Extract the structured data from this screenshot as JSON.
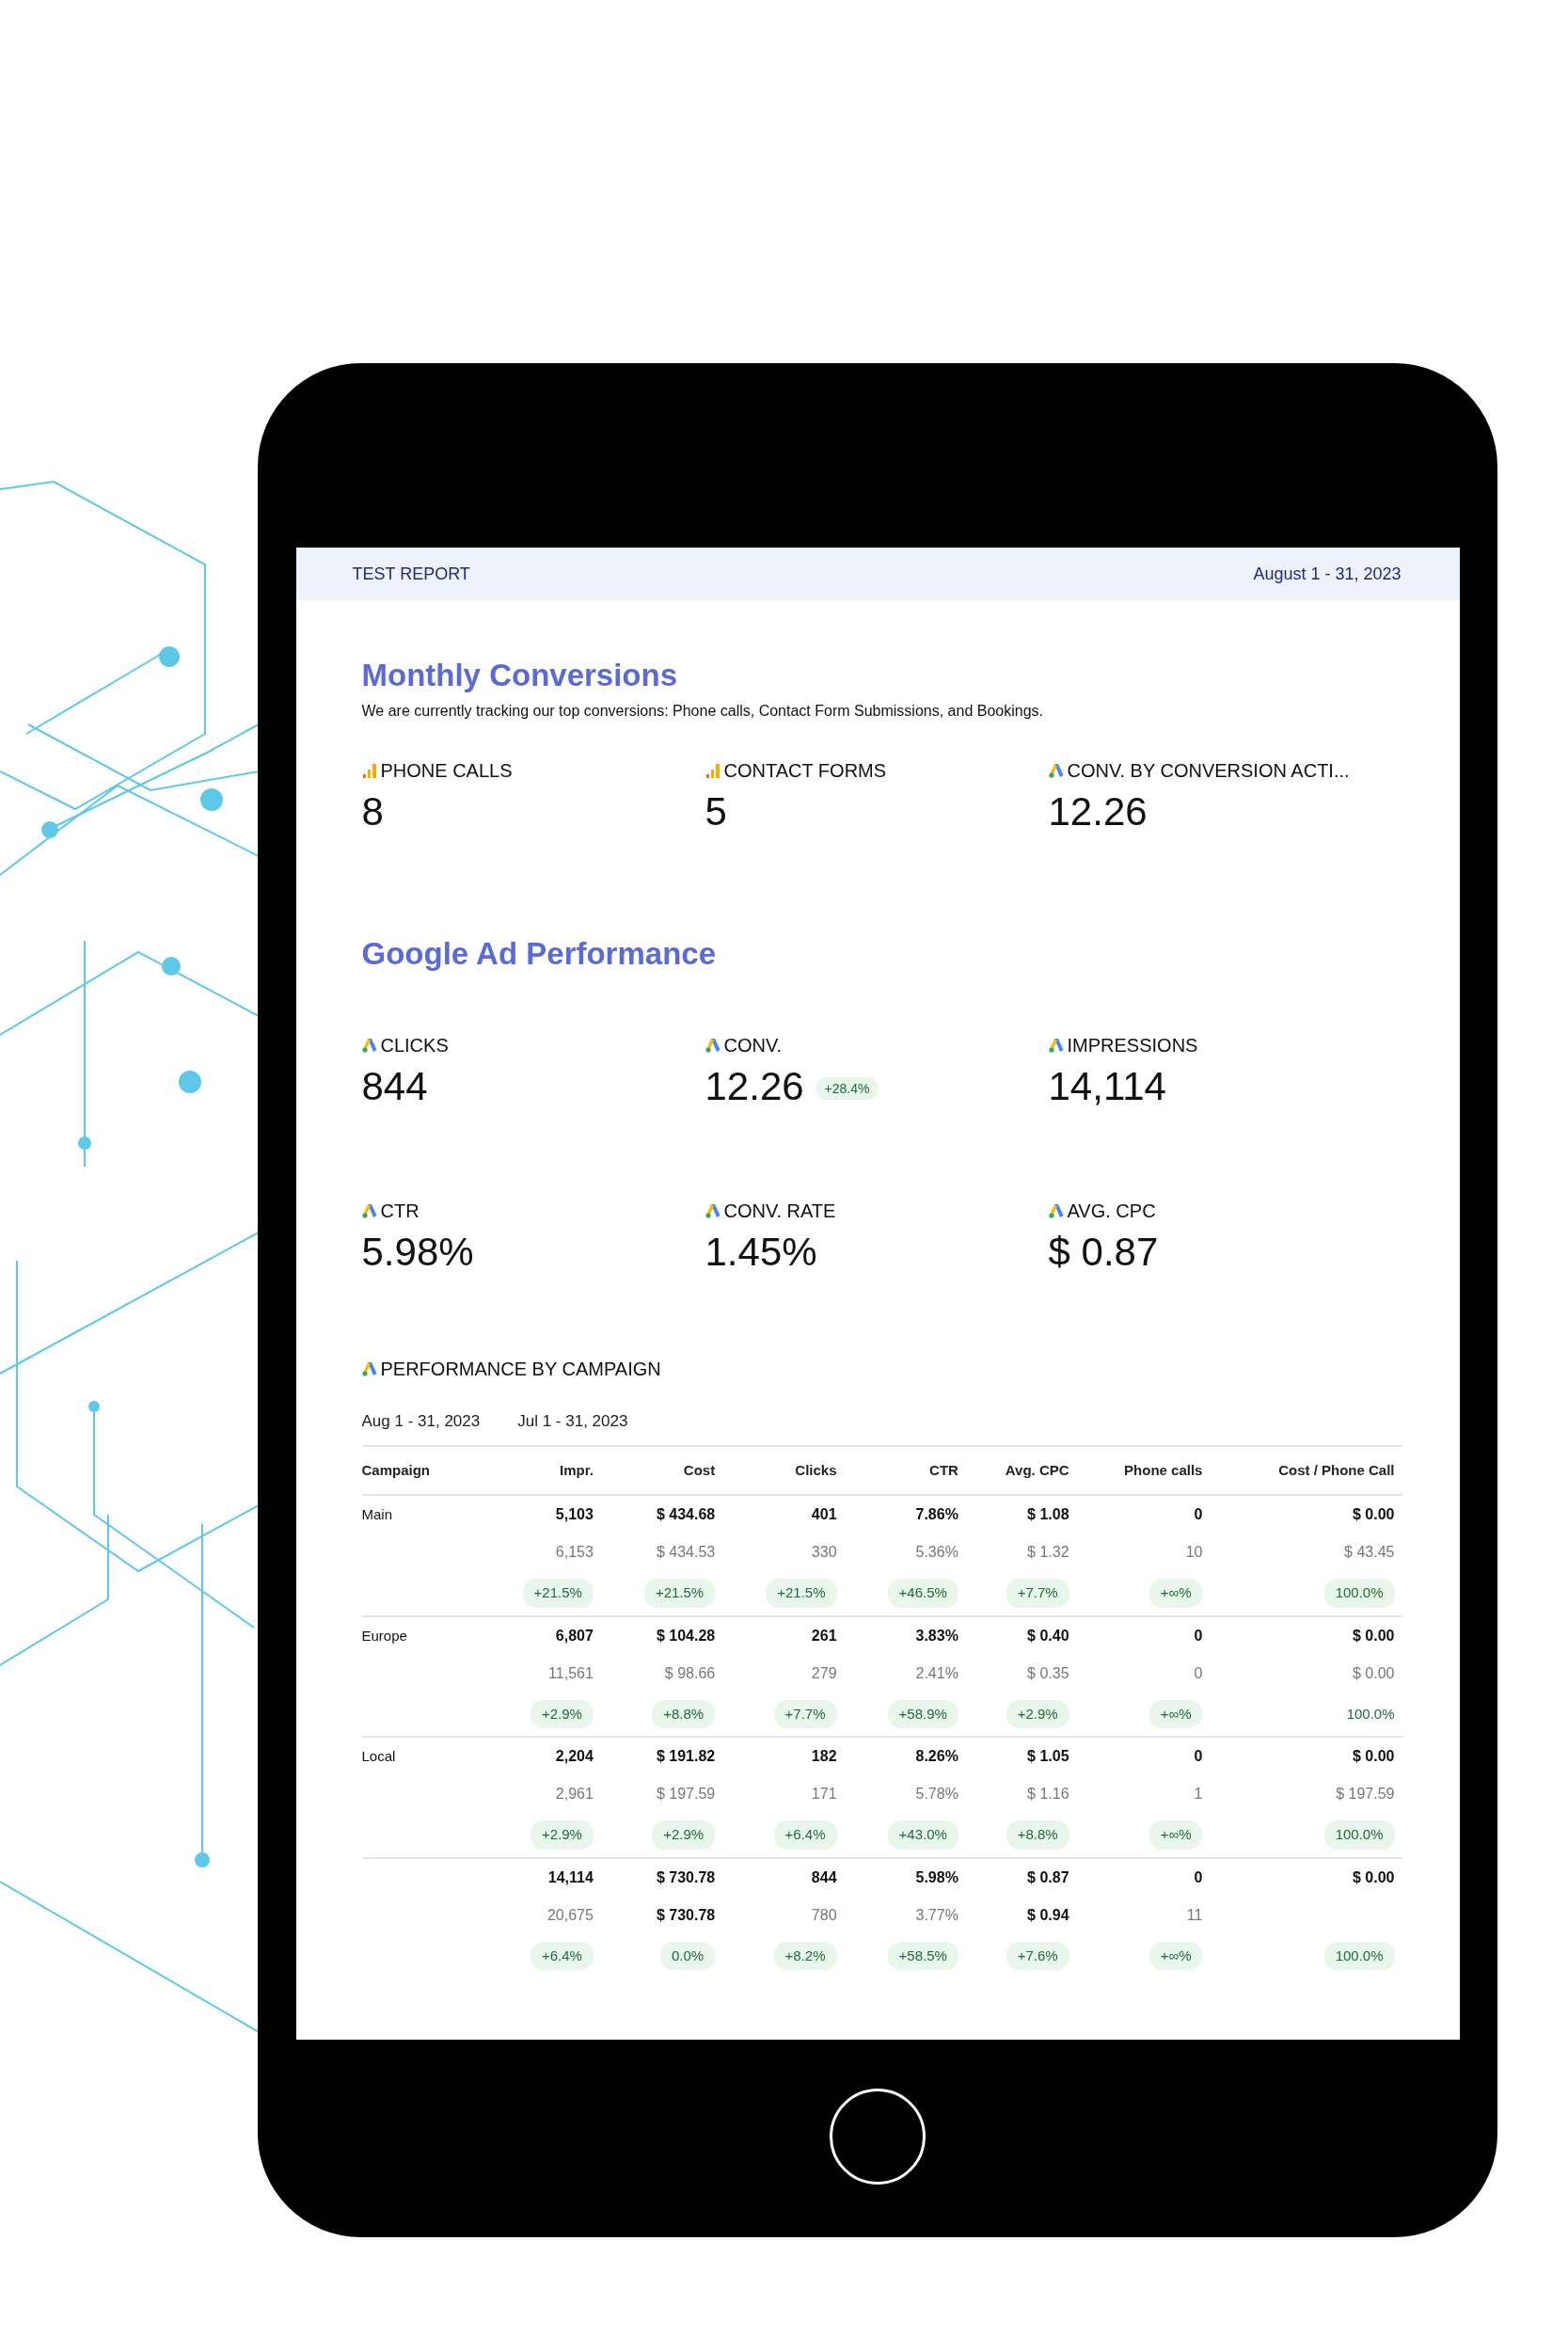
{
  "header": {
    "title": "TEST REPORT",
    "date_range": "August 1 - 31, 2023"
  },
  "sections": [
    {
      "title": "Monthly Conversions",
      "description": "We are currently tracking our top conversions: Phone calls, Contact Form Submissions, and Bookings.",
      "metrics": [
        {
          "kind": "bars",
          "label": "PHONE CALLS",
          "value": "8"
        },
        {
          "kind": "bars",
          "label": "CONTACT FORMS",
          "value": "5"
        },
        {
          "kind": "triangle",
          "label": "CONV. BY CONVERSION ACTI...",
          "value": "12.26"
        }
      ]
    },
    {
      "title": "Google Ad Performance",
      "metrics": [
        {
          "kind": "triangle",
          "label": "CLICKS",
          "value": "844"
        },
        {
          "kind": "triangle",
          "label": "CONV.",
          "value": "12.26",
          "change": "+28.4%"
        },
        {
          "kind": "triangle",
          "label": "IMPRESSIONS",
          "value": "14,114"
        },
        {
          "kind": "triangle",
          "label": "CTR",
          "value": "5.98%"
        },
        {
          "kind": "triangle",
          "label": "CONV. RATE",
          "value": "1.45%"
        },
        {
          "kind": "triangle",
          "label": "AVG. CPC",
          "value": "$ 0.87"
        }
      ]
    }
  ],
  "campaign_table": {
    "kind": "triangle",
    "title": "PERFORMANCE BY CAMPAIGN",
    "periods": [
      "Aug 1 - 31, 2023",
      "Jul 1 - 31, 2023"
    ],
    "columns": [
      "Campaign",
      "Impr.",
      "Cost",
      "Clicks",
      "CTR",
      "Avg. CPC",
      "Phone calls",
      "Cost / Phone Call"
    ],
    "rows": [
      {
        "campaign": "Main",
        "current": [
          "5,103",
          "$ 434.68",
          "401",
          "7.86%",
          "$ 1.08",
          "0",
          "$ 0.00"
        ],
        "previous": [
          {
            "text": "6,153",
            "bold": false
          },
          {
            "text": "$ 434.53",
            "bold": false
          },
          {
            "text": "330",
            "bold": false
          },
          {
            "text": "5.36%",
            "bold": false
          },
          {
            "text": "$ 1.32",
            "bold": false
          },
          {
            "text": "10",
            "bold": false
          },
          {
            "text": "$ 43.45",
            "bold": false
          }
        ],
        "changes": [
          {
            "text": "+21.5%",
            "pill": true
          },
          {
            "text": "+21.5%",
            "pill": true
          },
          {
            "text": "+21.5%",
            "pill": true
          },
          {
            "text": "+46.5%",
            "pill": true
          },
          {
            "text": "+7.7%",
            "pill": true
          },
          {
            "text": "+∞%",
            "pill": true
          },
          {
            "text": "100.0%",
            "pill": true
          }
        ]
      },
      {
        "campaign": "Europe",
        "current": [
          "6,807",
          "$ 104.28",
          "261",
          "3.83%",
          "$ 0.40",
          "0",
          "$ 0.00"
        ],
        "previous": [
          {
            "text": "11,561",
            "bold": false
          },
          {
            "text": "$ 98.66",
            "bold": false
          },
          {
            "text": "279",
            "bold": false
          },
          {
            "text": "2.41%",
            "bold": false
          },
          {
            "text": "$ 0.35",
            "bold": false
          },
          {
            "text": "0",
            "bold": false
          },
          {
            "text": "$ 0.00",
            "bold": false
          }
        ],
        "changes": [
          {
            "text": "+2.9%",
            "pill": true
          },
          {
            "text": "+8.8%",
            "pill": true
          },
          {
            "text": "+7.7%",
            "pill": true
          },
          {
            "text": "+58.9%",
            "pill": true
          },
          {
            "text": "+2.9%",
            "pill": true
          },
          {
            "text": "+∞%",
            "pill": true
          },
          {
            "text": "100.0%",
            "pill": false
          }
        ]
      },
      {
        "campaign": "Local",
        "current": [
          "2,204",
          "$ 191.82",
          "182",
          "8.26%",
          "$ 1.05",
          "0",
          "$ 0.00"
        ],
        "previous": [
          {
            "text": "2,961",
            "bold": false
          },
          {
            "text": "$ 197.59",
            "bold": false
          },
          {
            "text": "171",
            "bold": false
          },
          {
            "text": "5.78%",
            "bold": false
          },
          {
            "text": "$ 1.16",
            "bold": false
          },
          {
            "text": "1",
            "bold": false
          },
          {
            "text": "$ 197.59",
            "bold": false
          }
        ],
        "changes": [
          {
            "text": "+2.9%",
            "pill": true
          },
          {
            "text": "+2.9%",
            "pill": true
          },
          {
            "text": "+6.4%",
            "pill": true
          },
          {
            "text": "+43.0%",
            "pill": true
          },
          {
            "text": "+8.8%",
            "pill": true
          },
          {
            "text": "+∞%",
            "pill": true
          },
          {
            "text": "100.0%",
            "pill": true
          }
        ]
      },
      {
        "current": [
          "14,114",
          "$ 730.78",
          "844",
          "5.98%",
          "$ 0.87",
          "0",
          "$ 0.00"
        ],
        "previous": [
          {
            "text": "20,675",
            "bold": false
          },
          {
            "text": "$ 730.78",
            "bold": true
          },
          {
            "text": "780",
            "bold": false
          },
          {
            "text": "3.77%",
            "bold": false
          },
          {
            "text": "$ 0.94",
            "bold": true
          },
          {
            "text": "11",
            "bold": false
          }
        ],
        "changes": [
          {
            "text": "+6.4%",
            "pill": true
          },
          {
            "text": "0.0%",
            "pill": true
          },
          {
            "text": "+8.2%",
            "pill": true
          },
          {
            "text": "+58.5%",
            "pill": true
          },
          {
            "text": "+7.6%",
            "pill": true
          },
          {
            "text": "+∞%",
            "pill": true
          },
          {
            "text": "100.0%",
            "pill": true
          }
        ]
      }
    ]
  }
}
